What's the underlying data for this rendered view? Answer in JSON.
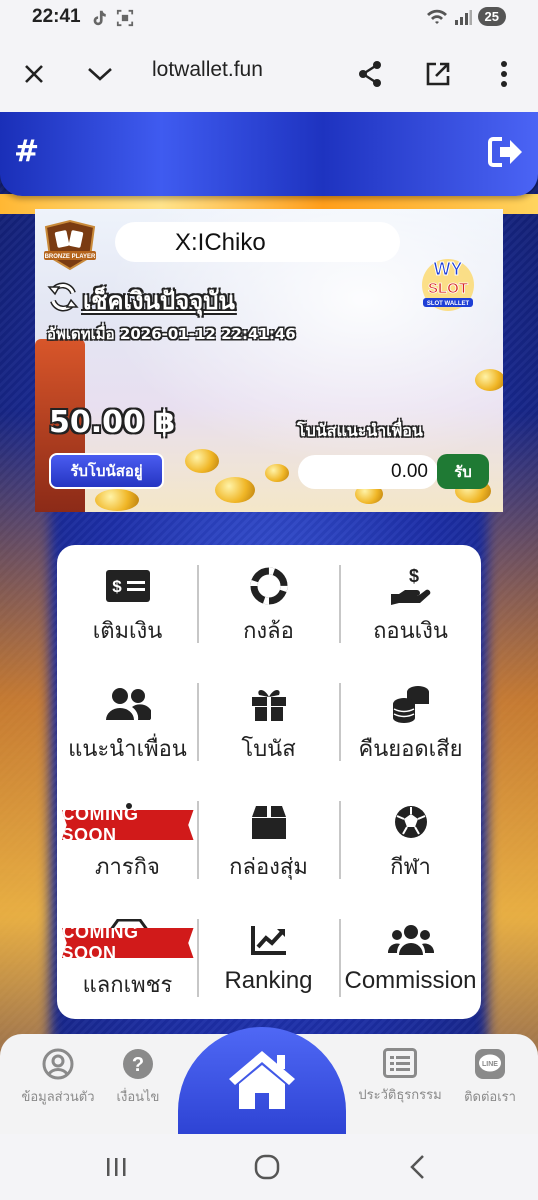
{
  "status_bar": {
    "time": "22:41",
    "battery": "25"
  },
  "browser": {
    "url": "lotwallet.fun"
  },
  "header": {
    "hash_label": "#"
  },
  "banner": {
    "rank_badge": "BRONZE PLAYER",
    "player_name": "X:IChiko",
    "logo_text_top": "WY",
    "logo_text_mid": "SLOT",
    "logo_text_bottom": "SLOT WALLET",
    "check_balance_title": "เช็คเงินปัจจุบัน",
    "updated_at": "อัพเดทเมื่อ 2026-01-12 22:41:46",
    "balance": "50.00 ฿",
    "referral_bonus_label": "โบนัสแนะนำเพื่อน",
    "referral_bonus_value": "0.00",
    "bonus_button": "รับโบนัสอยู่",
    "receive_button": "รับ"
  },
  "menu": {
    "coming_soon": "COMING SOON",
    "items": [
      {
        "label": "เติมเงิน",
        "icon": "money-bill-icon"
      },
      {
        "label": "กงล้อ",
        "icon": "life-ring-icon"
      },
      {
        "label": "ถอนเงิน",
        "icon": "hand-dollar-icon"
      },
      {
        "label": "แนะนำเพื่อน",
        "icon": "user-friends-icon"
      },
      {
        "label": "โบนัส",
        "icon": "gift-icon"
      },
      {
        "label": "คืนยอดเสีย",
        "icon": "coins-icon"
      },
      {
        "label": "ภารกิจ",
        "icon": "coming-soon-icon"
      },
      {
        "label": "กล่องสุ่ม",
        "icon": "box-icon"
      },
      {
        "label": "กีฬา",
        "icon": "soccer-ball-icon"
      },
      {
        "label": "แลกเพชร",
        "icon": "coming-soon-icon"
      },
      {
        "label": "Ranking",
        "icon": "chart-line-icon"
      },
      {
        "label": "Commission",
        "icon": "users-icon"
      }
    ]
  },
  "bottom_nav": {
    "items": [
      {
        "label": "ข้อมูลส่วนตัว",
        "icon": "user-circle-icon"
      },
      {
        "label": "เงื่อนไข",
        "icon": "question-circle-icon"
      },
      {
        "label": "ประวัติธุรกรรม",
        "icon": "list-alt-icon"
      },
      {
        "label": "ติดต่อเรา",
        "icon": "line-icon"
      }
    ],
    "home_icon": "home-icon",
    "line_text": "LINE"
  },
  "colors": {
    "accent_blue": "#2a3fd0",
    "gold": "#ffb733",
    "receive_green": "#1f7a34",
    "coming_soon_red": "#d11a1a"
  }
}
